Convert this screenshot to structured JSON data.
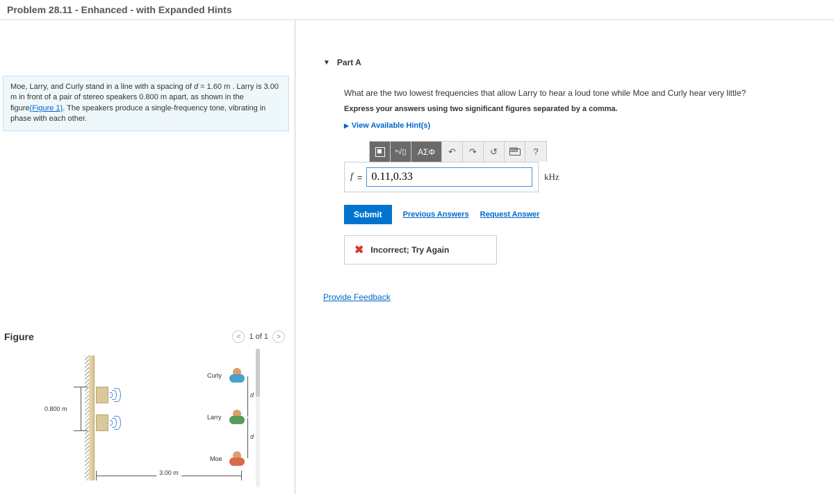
{
  "header": {
    "title": "Problem 28.11 - Enhanced - with Expanded Hints"
  },
  "problem": {
    "text_pre": "Moe, Larry, and Curly stand in a line with a spacing of ",
    "var_d": "d",
    "eq": " = 1.60 ",
    "unit_m": "m",
    "text_mid": " . Larry is 3.00 ",
    "text_mid2": " in front of a pair of stereo speakers 0.800 ",
    "text_mid3": " apart, as shown in the figure",
    "fig_link": "(Figure 1)",
    "text_end": ". The speakers produce a single-frequency tone, vibrating in phase with each other."
  },
  "figure": {
    "title": "Figure",
    "nav_prev": "<",
    "nav_label": "1 of 1",
    "nav_next": ">",
    "dim_v": "0.800 m",
    "dim_h": "3.00 m",
    "curly": "Curly",
    "larry": "Larry",
    "moe": "Moe",
    "d": "d"
  },
  "part": {
    "label": "Part A",
    "question": "What are the two lowest frequencies that allow Larry to hear a loud tone while Moe and Curly hear very little?",
    "instruction": "Express your answers using two significant figures separated by a comma.",
    "hints_label": "View Available Hint(s)",
    "toolbar": {
      "greek": "ΑΣΦ",
      "undo": "↶",
      "redo": "↷",
      "reset": "↺",
      "help": "?"
    },
    "answer": {
      "var": "f",
      "eq": "=",
      "value": "0.11,0.33",
      "unit": "kHz"
    },
    "submit": "Submit",
    "prev_answers": "Previous Answers",
    "request_answer": "Request Answer",
    "feedback": "Incorrect; Try Again",
    "provide_feedback": "Provide Feedback"
  }
}
